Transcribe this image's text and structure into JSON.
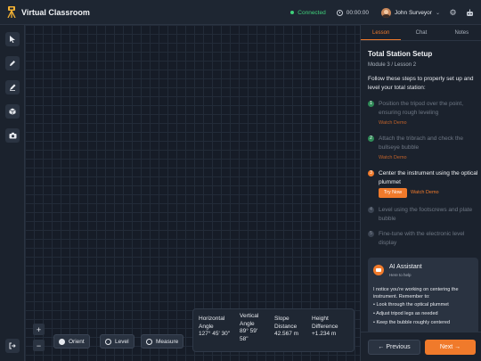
{
  "header": {
    "app_title": "Virtual Classroom",
    "status": "Connected",
    "timer": "00:00:00",
    "user_name": "John Surveyor",
    "status_color": "#3fcf7a",
    "accent_color": "#f07a2b"
  },
  "toolbar": {
    "tools": [
      "pointer-icon",
      "pencil-icon",
      "pen-icon",
      "cube-icon",
      "camera-icon"
    ],
    "exit_icon": "exit-icon"
  },
  "canvas": {
    "zoom_in": "+",
    "zoom_out": "−",
    "controls": {
      "orient": "Orient",
      "level": "Level",
      "measure": "Measure"
    },
    "readout": {
      "horizontal_angle_label_1": "Horizontal",
      "horizontal_angle_label_2": "Angle",
      "horizontal_angle_value": "127° 45' 30\"",
      "vertical_angle_label_1": "Vertical",
      "vertical_angle_label_2": "Angle",
      "vertical_angle_value_1": "89° 59'",
      "vertical_angle_value_2": "58\"",
      "slope_distance_label_1": "Slope",
      "slope_distance_label_2": "Distance",
      "slope_distance_value": "42.567 m",
      "height_difference_label_1": "Height",
      "height_difference_label_2": "Difference",
      "height_difference_value": "+1.234 m"
    }
  },
  "panel": {
    "tabs": [
      "Lesson",
      "Chat",
      "Notes"
    ],
    "lesson_title": "Total Station Setup",
    "lesson_sub": "Module 3 / Lesson 2",
    "intro": "Follow these steps to properly set up and level your total station:",
    "steps": [
      {
        "num": "1",
        "text": "Position the tripod over the point, ensuring rough leveling",
        "demo": "Watch Demo"
      },
      {
        "num": "2",
        "text": "Attach the tribrach and check the bullseye bubble",
        "demo": "Watch Demo"
      },
      {
        "num": "3",
        "text": "Center the instrument using the optical plummet",
        "try": "Try Now",
        "demo": "Watch Demo"
      },
      {
        "num": "4",
        "text": "Level using the footscrews and plate bubble"
      },
      {
        "num": "5",
        "text": "Fine-tune with the electronic level display"
      }
    ],
    "ai": {
      "title": "AI Assistant",
      "subtitle": "Here to help",
      "message": "I notice you're working on centering the instrument. Remember to:",
      "bullets": [
        "• Look through the optical plummet",
        "• Adjust tripod legs as needed",
        "• Keep the bubble roughly centered"
      ]
    },
    "prev": "Previous",
    "next": "Next"
  }
}
